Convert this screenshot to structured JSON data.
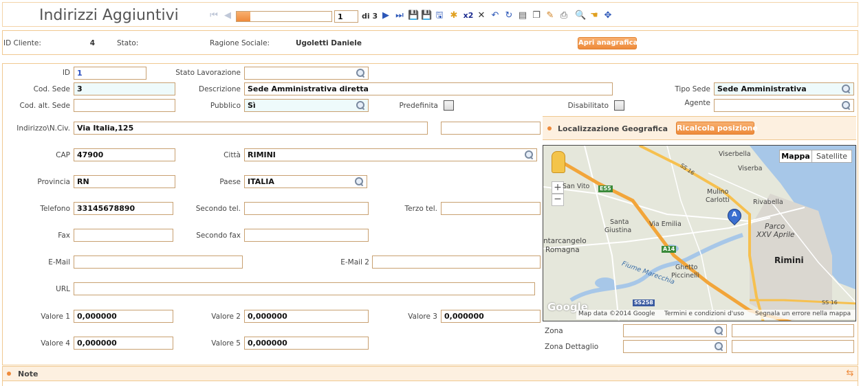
{
  "page": {
    "title": "Indirizzi Aggiuntivi"
  },
  "toolbar": {
    "record_current": "1",
    "record_of_label": "di 3",
    "x2_label": "x2",
    "icons": [
      "first-record-icon",
      "previous-record-icon",
      "next-record-icon",
      "last-record-icon",
      "save-icon",
      "save-as-icon",
      "save-new-icon",
      "new-record-icon",
      "duplicate-icon",
      "delete-icon",
      "undo-icon",
      "refresh-icon",
      "export-icon",
      "copy-icon",
      "edit-icon",
      "print-icon",
      "preview-icon",
      "hand-icon",
      "move-icon"
    ]
  },
  "header": {
    "id_cliente_label": "ID Cliente:",
    "id_cliente_value": "4",
    "stato_label": "Stato:",
    "ragione_sociale_label": "Ragione Sociale:",
    "ragione_sociale_value": "Ugoletti Daniele",
    "apri_anagrafica_label": "Apri anagrafica"
  },
  "form": {
    "id_label": "ID",
    "id_value": "1",
    "stato_lavorazione_label": "Stato Lavorazione",
    "stato_lavorazione_value": "",
    "cod_sede_label": "Cod. Sede",
    "cod_sede_value": "3",
    "descrizione_label": "Descrizione",
    "descrizione_value": "Sede Amministrativa diretta",
    "tipo_sede_label": "Tipo Sede",
    "tipo_sede_value": "Sede Amministrativa",
    "cod_alt_sede_label": "Cod. alt. Sede",
    "cod_alt_sede_value": "",
    "pubblico_label": "Pubblico",
    "pubblico_value": "Sì",
    "predefinita_label": "Predefinita",
    "disabilitato_label": "Disabilitato",
    "agente_label": "Agente",
    "agente_value": "",
    "indirizzo_label": "Indirizzo\\N.Civ.",
    "indirizzo_value": "Via Italia,125",
    "civico_value": "",
    "cap_label": "CAP",
    "cap_value": "47900",
    "citta_label": "Città",
    "citta_value": "RIMINI",
    "provincia_label": "Provincia",
    "provincia_value": "RN",
    "paese_label": "Paese",
    "paese_value": "ITALIA",
    "telefono_label": "Telefono",
    "telefono_value": "33145678890",
    "secondo_tel_label": "Secondo tel.",
    "secondo_tel_value": "",
    "terzo_tel_label": "Terzo tel.",
    "terzo_tel_value": "",
    "fax_label": "Fax",
    "fax_value": "",
    "secondo_fax_label": "Secondo fax",
    "secondo_fax_value": "",
    "email_label": "E-Mail",
    "email_value": "",
    "email2_label": "E-Mail 2",
    "email2_value": "",
    "url_label": "URL",
    "url_value": "",
    "valore1_label": "Valore 1",
    "valore1_value": "0,000000",
    "valore2_label": "Valore 2",
    "valore2_value": "0,000000",
    "valore3_label": "Valore 3",
    "valore3_value": "0,000000",
    "valore4_label": "Valore 4",
    "valore4_value": "0,000000",
    "valore5_label": "Valore 5",
    "valore5_value": "0,000000",
    "zona_label": "Zona",
    "zona_value": "",
    "zona_dettaglio_label": "Zona Dettaglio",
    "zona_dettaglio_value": ""
  },
  "geo": {
    "title": "Localizzazione Geografica",
    "ricalcola_label": "Ricalcola posizione"
  },
  "map": {
    "type_map": "Mappa",
    "type_satellite": "Satellite",
    "marker_label": "A",
    "footer_data": "Map data ©2014 Google",
    "footer_terms": "Termini e condizioni d'uso",
    "footer_report": "Segnala un errore nella mappa",
    "google": "Google",
    "places": {
      "viserbella": "Viserbella",
      "viserba": "Viserba",
      "san_vito": "San Vito",
      "mulino_carlotti_1": "Mulino",
      "mulino_carlotti_2": "Carlotti",
      "rivabella": "Rivabella",
      "santa_giustina_1": "Santa",
      "santa_giustina_2": "Giustina",
      "via_emilia": "Via Emilia",
      "parco_1": "Parco",
      "parco_2": "XXV Aprile",
      "santarcangelo_1": "ntarcangelo",
      "santarcangelo_2": "Romagna",
      "rimini": "Rimini",
      "ghetto_1": "Ghetto",
      "ghetto_2": "Piccinelli",
      "fiume": "Fiume Marecchia",
      "ss16_a": "SS 16",
      "ss16_b": "SS 16",
      "e55": "E55",
      "a14": "A14",
      "ss258": "SS258"
    }
  },
  "note": {
    "title": "Note"
  },
  "colors": {
    "accent": "#ee8a3a",
    "border": "#f0c890",
    "field_required_bg": "#eefafb"
  }
}
